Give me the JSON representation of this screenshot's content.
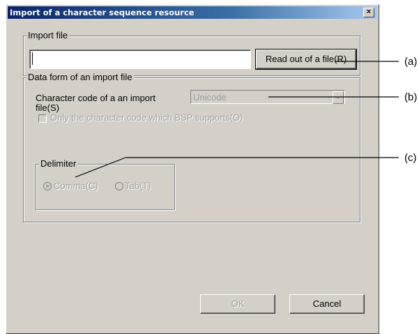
{
  "window": {
    "title": "Import of a character sequence resource",
    "close_glyph": "×"
  },
  "import_file": {
    "group_label": "Import file",
    "path_value": "",
    "read_button_label": "Read out of a file(R)"
  },
  "data_form": {
    "group_label": "Data form of an import file",
    "char_code_label_line1": "Character code of a an import",
    "char_code_label_line2": "file(S)",
    "char_code_value": "Unicode",
    "bsp_checkbox_label": "Only the character code which BSP supports(O)",
    "bsp_checked": false,
    "delimiter": {
      "group_label": "Delimiter",
      "options": [
        {
          "label": "Comma(C)",
          "checked": true
        },
        {
          "label": "Tab(T)",
          "checked": false
        }
      ]
    }
  },
  "footer": {
    "ok_label": "OK",
    "cancel_label": "Cancel"
  },
  "annotations": {
    "a": "(a)",
    "b": "(b)",
    "c": "(c)"
  },
  "colors": {
    "title_gradient_start": "#0a246a",
    "title_gradient_end": "#a6caf0",
    "dialog_face": "#d4d0c8",
    "disabled_text": "#a0a0a0"
  }
}
